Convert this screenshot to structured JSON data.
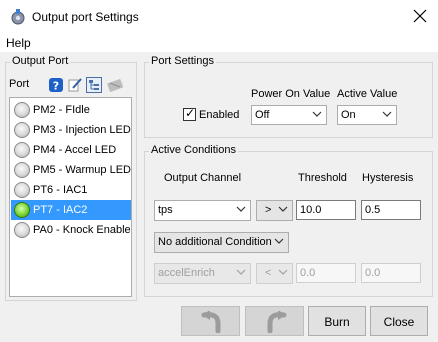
{
  "window": {
    "title": "Output port Settings",
    "close_icon": "close-icon",
    "app_icon": "settings-app-icon"
  },
  "menu": {
    "help": "Help"
  },
  "output_port": {
    "group_title": "Output Port",
    "port_label": "Port",
    "tool_icons": [
      "help-icon",
      "edit-icon",
      "tree-icon",
      "disabled-icon"
    ],
    "ports": [
      {
        "name": "PM2 - FIdle",
        "led": "off",
        "selected": false
      },
      {
        "name": "PM3 - Injection LED",
        "led": "off",
        "selected": false
      },
      {
        "name": "PM4 - Accel LED",
        "led": "off",
        "selected": false
      },
      {
        "name": "PM5 - Warmup LED",
        "led": "off",
        "selected": false
      },
      {
        "name": "PT6 - IAC1",
        "led": "off",
        "selected": false
      },
      {
        "name": "PT7 - IAC2",
        "led": "on",
        "selected": true
      },
      {
        "name": "PA0 - Knock Enable",
        "led": "off",
        "selected": false
      }
    ]
  },
  "port_settings": {
    "group_title": "Port Settings",
    "enabled_label": "Enabled",
    "enabled_checked": true,
    "power_on_label": "Power On Value",
    "power_on_value": "Off",
    "active_value_label": "Active Value",
    "active_value": "On"
  },
  "active_conditions": {
    "group_title": "Active Conditions",
    "output_channel_label": "Output Channel",
    "threshold_label": "Threshold",
    "hysteresis_label": "Hysteresis",
    "row1": {
      "channel": "tps",
      "operator": ">",
      "threshold": "10.0",
      "hysteresis": "0.5"
    },
    "additional_condition": "No additional Condition",
    "row2": {
      "channel": "accelEnrich",
      "operator": "<",
      "threshold": "0.0",
      "hysteresis": "0.0"
    }
  },
  "buttons": {
    "undo_icon": "undo-icon",
    "redo_icon": "redo-icon",
    "burn": "Burn",
    "close": "Close"
  },
  "colors": {
    "selection": "#3399ff",
    "led_on": "#7ad334",
    "window_bg": "#f0f0f0"
  }
}
